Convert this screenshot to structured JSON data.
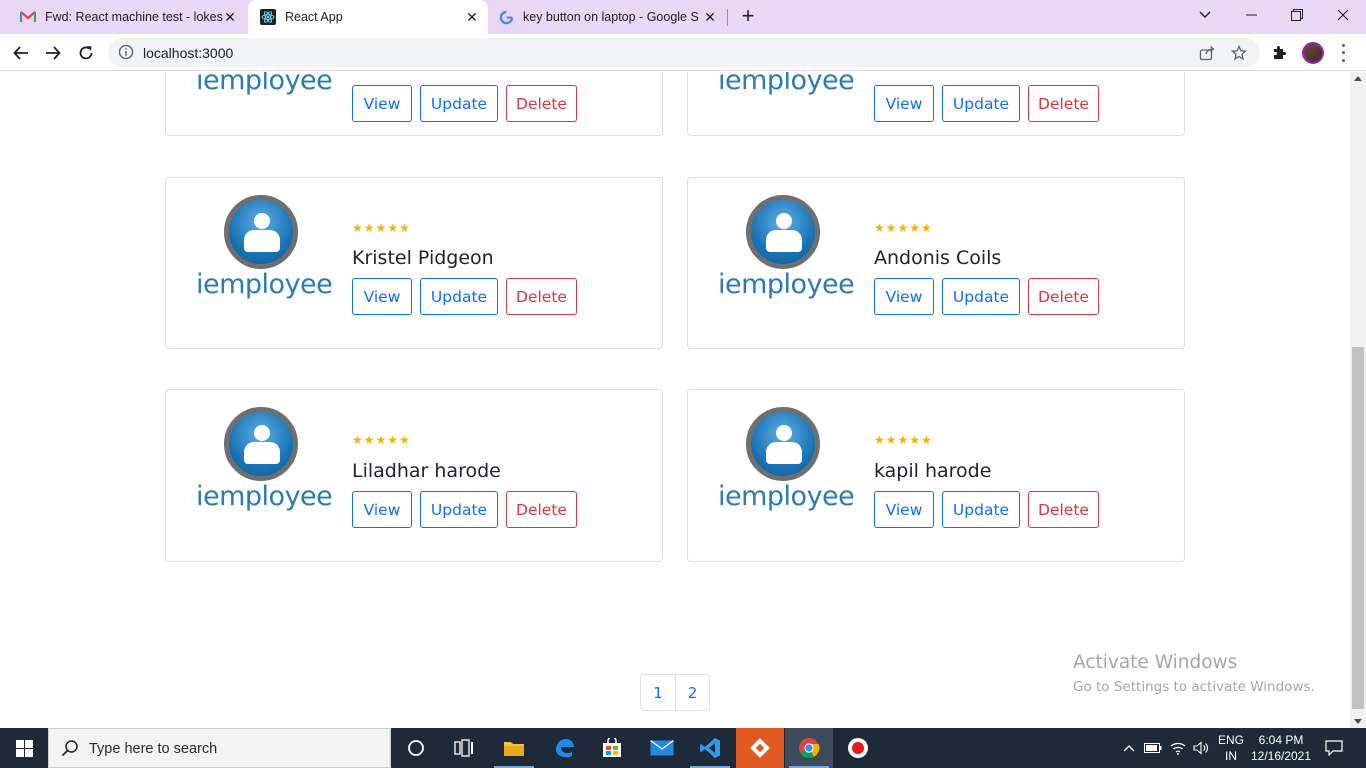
{
  "browser": {
    "tabs": [
      {
        "title": "Fwd: React machine test - lokesh",
        "active": false,
        "favicon": "gmail-icon"
      },
      {
        "title": "React App",
        "active": true,
        "favicon": "react-icon"
      },
      {
        "title": "key button on laptop - Google Se",
        "active": false,
        "favicon": "google-icon"
      }
    ],
    "url": "localhost:3000"
  },
  "page": {
    "buttons": {
      "view": "View",
      "update": "Update",
      "delete": "Delete"
    },
    "logo_text": "iemployee",
    "employees": [
      {
        "name": "",
        "rating": "★★★★★"
      },
      {
        "name": "",
        "rating": "★★★★★"
      },
      {
        "name": "Kristel Pidgeon",
        "rating": "★★★★★"
      },
      {
        "name": "Andonis Coils",
        "rating": "★★★★★"
      },
      {
        "name": "Liladhar harode",
        "rating": "★★★★★"
      },
      {
        "name": "kapil harode",
        "rating": "★★★★★"
      }
    ],
    "pagination": [
      "1",
      "2"
    ]
  },
  "watermark": {
    "title": "Activate Windows",
    "subtitle": "Go to Settings to activate Windows."
  },
  "taskbar": {
    "search_placeholder": "Type here to search",
    "lang_line1": "ENG",
    "lang_line2": "IN",
    "time": "6:04 PM",
    "date": "12/16/2021"
  },
  "colors": {
    "primary": "#0d6efd",
    "danger": "#dc3545",
    "star": "#f4b400",
    "tabstrip": "#e8d7f5"
  }
}
